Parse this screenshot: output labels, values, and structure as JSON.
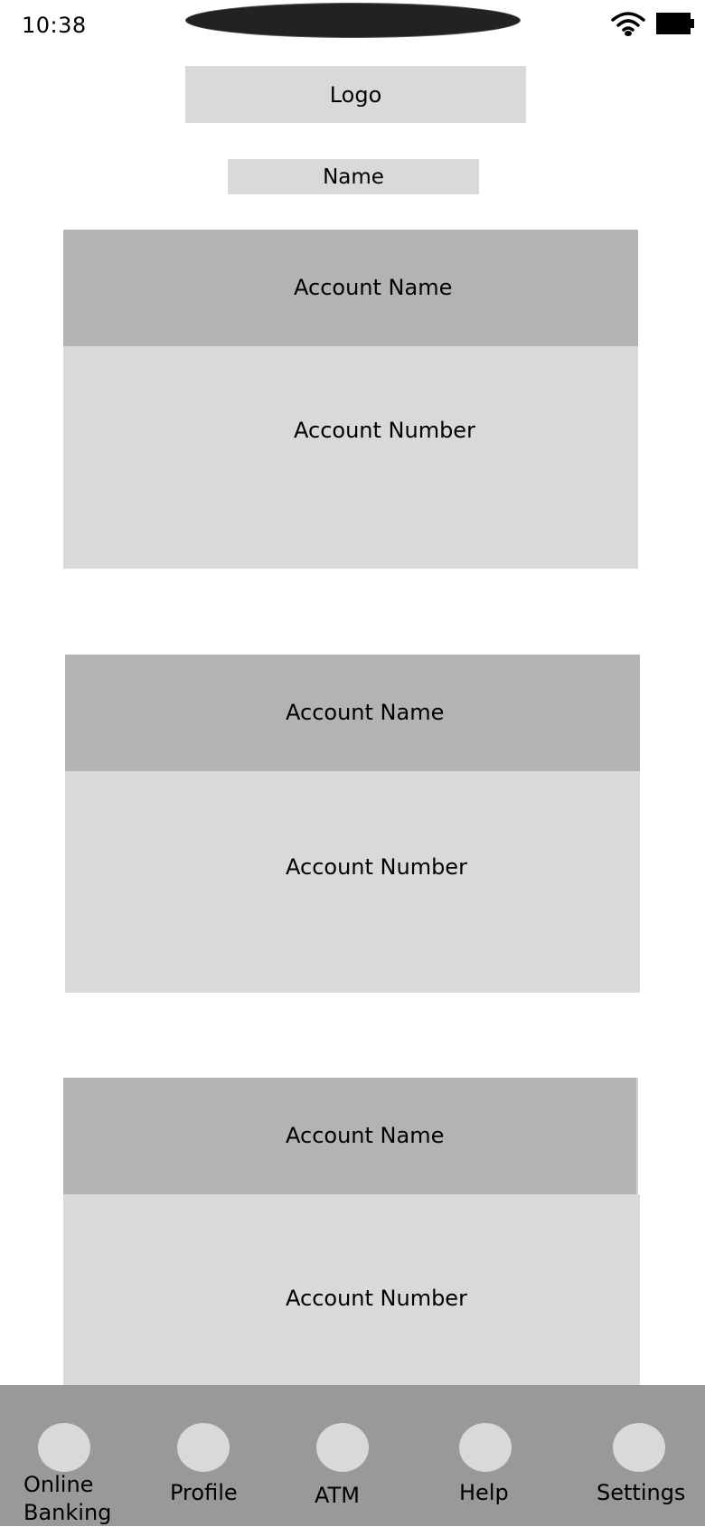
{
  "status_bar": {
    "time": "10:38",
    "icons": [
      "wifi-icon",
      "battery-icon"
    ]
  },
  "header": {
    "logo_label": "Logo",
    "name_label": "Name"
  },
  "accounts": [
    {
      "name_label": "Account Name",
      "number_label": "Account Number"
    },
    {
      "name_label": "Account Name",
      "number_label": "Account Number"
    },
    {
      "name_label": "Account Name",
      "number_label": "Account Number"
    }
  ],
  "bottom_nav": {
    "items": [
      {
        "label": "Online\nBanking",
        "icon": "online-banking-icon"
      },
      {
        "label": "Profile",
        "icon": "profile-icon"
      },
      {
        "label": "ATM",
        "icon": "atm-icon"
      },
      {
        "label": "Help",
        "icon": "help-icon"
      },
      {
        "label": "Settings",
        "icon": "settings-icon"
      }
    ]
  },
  "colors": {
    "placeholder_light": "#d9d9d9",
    "placeholder_dark": "#b3b3b3",
    "nav_background": "#999999",
    "notch": "#222222"
  }
}
